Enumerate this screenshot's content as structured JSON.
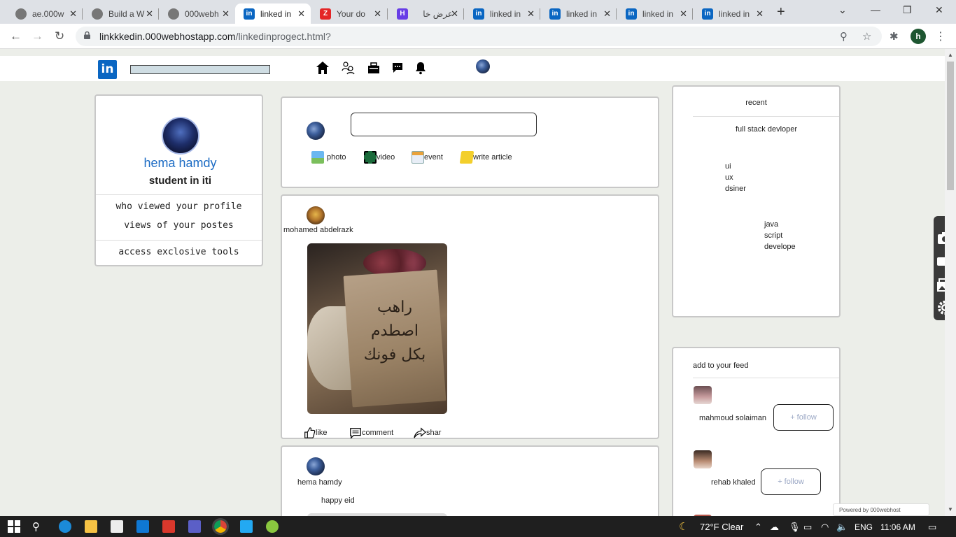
{
  "browser": {
    "tabs": [
      {
        "title": "ae.000w",
        "icon": "globe-icon",
        "color": "#777777"
      },
      {
        "title": "Build a W",
        "icon": "globe-icon",
        "color": "#777777"
      },
      {
        "title": "000webh",
        "icon": "globe-icon",
        "color": "#777777"
      },
      {
        "title": "linked in",
        "icon": "linkedin-icon",
        "color": "#0a66c2",
        "active": true
      },
      {
        "title": "Your do",
        "icon": "zoho-icon",
        "color": "#e42527"
      },
      {
        "title": "عرض خا",
        "icon": "hostinger-icon",
        "color": "#673de6"
      },
      {
        "title": "linked in",
        "icon": "linkedin-icon",
        "color": "#0a66c2"
      },
      {
        "title": "linked in",
        "icon": "linkedin-icon",
        "color": "#0a66c2"
      },
      {
        "title": "linked in",
        "icon": "linkedin-icon",
        "color": "#0a66c2"
      },
      {
        "title": "linked in",
        "icon": "linkedin-icon",
        "color": "#0a66c2"
      }
    ],
    "url_host": "linkkkedin.000webhostapp.com",
    "url_path": "/linkedinprogect.html?",
    "profile_initial": "h"
  },
  "header": {
    "logo_text": "in",
    "icons": [
      "home-icon",
      "network-icon",
      "jobs-icon",
      "messaging-icon",
      "notifications-icon",
      "me-avatar"
    ]
  },
  "profile": {
    "name": "hema hamdy",
    "title": "student in iti",
    "links": [
      "who viewed your profile",
      "views of your postes",
      "access exclosive tools"
    ]
  },
  "compose": {
    "actions": [
      {
        "label": "photo",
        "icon": "photo-icon"
      },
      {
        "label": "video",
        "icon": "video-icon"
      },
      {
        "label": "event",
        "icon": "event-icon"
      },
      {
        "label": "write article",
        "icon": "article-icon"
      }
    ]
  },
  "post": {
    "author": "mohamed abdelrazk",
    "image_text": "راهب اصطدم بكل فونك",
    "actions": [
      {
        "label": "like",
        "icon": "like-icon"
      },
      {
        "label": "comment",
        "icon": "comment-icon"
      },
      {
        "label": "shar",
        "icon": "share-icon"
      }
    ]
  },
  "post2": {
    "author": "hema hamdy",
    "text": "happy eid"
  },
  "recent": {
    "title": "recent",
    "groups": [
      [
        "full stack devloper"
      ],
      [
        "ui",
        "ux",
        "dsiner"
      ],
      [
        "java",
        "script",
        "develope"
      ]
    ]
  },
  "feed": {
    "title": "add to your feed",
    "people": [
      {
        "name": "mahmoud solaiman",
        "button": "+ follow"
      },
      {
        "name": "rehab khaled",
        "button": "+ follow"
      }
    ]
  },
  "watermark": "Powered by  000webhost",
  "taskbar": {
    "weather": "72°F  Clear",
    "language": "ENG",
    "time": "11:06 AM"
  },
  "colors": {
    "accent": "#0a66c2",
    "name_blue": "#1d6cc4",
    "page_bg": "#eceee9"
  }
}
